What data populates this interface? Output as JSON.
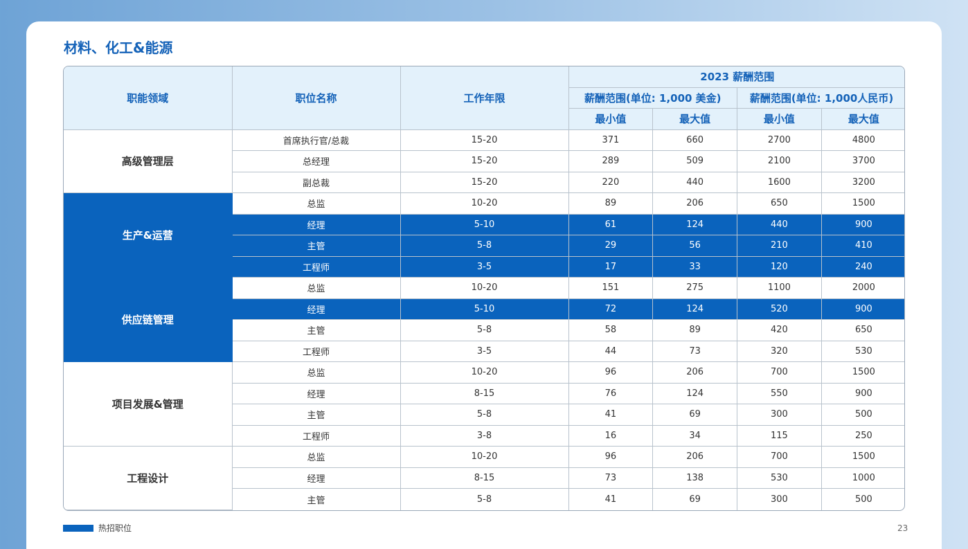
{
  "page": {
    "title": "材料、化工&能源",
    "footer_label": "热招职位",
    "page_number": "23"
  },
  "colors": {
    "accent": "#0a63bd",
    "header_bg": "#e3f1fb",
    "title": "#1462b8"
  },
  "table": {
    "headers": {
      "function": "职能领域",
      "position": "职位名称",
      "years": "工作年限",
      "salary_range": "2023 薪酬范围",
      "usd": "薪酬范围(单位: 1,000 美金)",
      "rmb": "薪酬范围(单位: 1,000人民币)",
      "min": "最小值",
      "max": "最大值"
    },
    "groups": [
      {
        "name": "高级管理层",
        "highlight": false,
        "rows": [
          {
            "title": "首席执行官/总裁",
            "years": "15-20",
            "usd_min": "371",
            "usd_max": "660",
            "rmb_min": "2700",
            "rmb_max": "4800",
            "highlight": false
          },
          {
            "title": "总经理",
            "years": "15-20",
            "usd_min": "289",
            "usd_max": "509",
            "rmb_min": "2100",
            "rmb_max": "3700",
            "highlight": false
          },
          {
            "title": "副总裁",
            "years": "15-20",
            "usd_min": "220",
            "usd_max": "440",
            "rmb_min": "1600",
            "rmb_max": "3200",
            "highlight": false
          }
        ]
      },
      {
        "name": "生产&运营",
        "highlight": true,
        "rows": [
          {
            "title": "总监",
            "years": "10-20",
            "usd_min": "89",
            "usd_max": "206",
            "rmb_min": "650",
            "rmb_max": "1500",
            "highlight": false
          },
          {
            "title": "经理",
            "years": "5-10",
            "usd_min": "61",
            "usd_max": "124",
            "rmb_min": "440",
            "rmb_max": "900",
            "highlight": true
          },
          {
            "title": "主管",
            "years": "5-8",
            "usd_min": "29",
            "usd_max": "56",
            "rmb_min": "210",
            "rmb_max": "410",
            "highlight": true
          },
          {
            "title": "工程师",
            "years": "3-5",
            "usd_min": "17",
            "usd_max": "33",
            "rmb_min": "120",
            "rmb_max": "240",
            "highlight": true
          }
        ]
      },
      {
        "name": "供应链管理",
        "highlight": true,
        "rows": [
          {
            "title": "总监",
            "years": "10-20",
            "usd_min": "151",
            "usd_max": "275",
            "rmb_min": "1100",
            "rmb_max": "2000",
            "highlight": false
          },
          {
            "title": "经理",
            "years": "5-10",
            "usd_min": "72",
            "usd_max": "124",
            "rmb_min": "520",
            "rmb_max": "900",
            "highlight": true
          },
          {
            "title": "主管",
            "years": "5-8",
            "usd_min": "58",
            "usd_max": "89",
            "rmb_min": "420",
            "rmb_max": "650",
            "highlight": false
          },
          {
            "title": "工程师",
            "years": "3-5",
            "usd_min": "44",
            "usd_max": "73",
            "rmb_min": "320",
            "rmb_max": "530",
            "highlight": false
          }
        ]
      },
      {
        "name": "项目发展&管理",
        "highlight": false,
        "rows": [
          {
            "title": "总监",
            "years": "10-20",
            "usd_min": "96",
            "usd_max": "206",
            "rmb_min": "700",
            "rmb_max": "1500",
            "highlight": false
          },
          {
            "title": "经理",
            "years": "8-15",
            "usd_min": "76",
            "usd_max": "124",
            "rmb_min": "550",
            "rmb_max": "900",
            "highlight": false
          },
          {
            "title": "主管",
            "years": "5-8",
            "usd_min": "41",
            "usd_max": "69",
            "rmb_min": "300",
            "rmb_max": "500",
            "highlight": false
          },
          {
            "title": "工程师",
            "years": "3-8",
            "usd_min": "16",
            "usd_max": "34",
            "rmb_min": "115",
            "rmb_max": "250",
            "highlight": false
          }
        ]
      },
      {
        "name": "工程设计",
        "highlight": false,
        "rows": [
          {
            "title": "总监",
            "years": "10-20",
            "usd_min": "96",
            "usd_max": "206",
            "rmb_min": "700",
            "rmb_max": "1500",
            "highlight": false
          },
          {
            "title": "经理",
            "years": "8-15",
            "usd_min": "73",
            "usd_max": "138",
            "rmb_min": "530",
            "rmb_max": "1000",
            "highlight": false
          },
          {
            "title": "主管",
            "years": "5-8",
            "usd_min": "41",
            "usd_max": "69",
            "rmb_min": "300",
            "rmb_max": "500",
            "highlight": false
          }
        ]
      }
    ]
  }
}
